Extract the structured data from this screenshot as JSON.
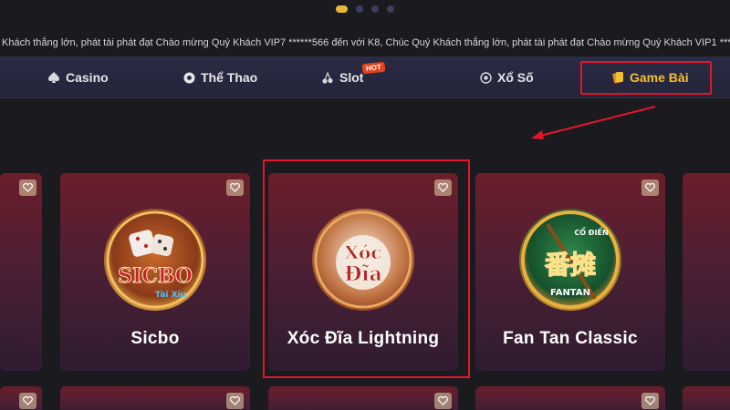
{
  "carousel": {
    "dots": 4,
    "active_index": 0
  },
  "marquee": {
    "text": "Khách thắng lớn, phát tài phát đạt Chào mừng Quý Khách VIP7 ******566 đến với K8, Chúc Quý Khách thắng lớn, phát tài phát đạt Chào mừng Quý Khách VIP1 ******"
  },
  "nav": {
    "items": [
      {
        "label": "Casino",
        "icon": "spade-icon"
      },
      {
        "label": "Thể Thao",
        "icon": "soccer-ball-icon"
      },
      {
        "label": "Slot",
        "icon": "cherry-icon",
        "badge": "HOT"
      },
      {
        "label": "Xổ Số",
        "icon": "lottery-ball-icon"
      },
      {
        "label": "Game Bài",
        "icon": "cards-icon",
        "active": true
      }
    ]
  },
  "games": [
    {
      "title": "Sicbo",
      "logo_text": "SICBO",
      "logo_sub": "Tài Xỉu"
    },
    {
      "title": "Xóc Đĩa Lightning",
      "logo_text": "Xóc",
      "logo_sub": "Đĩa"
    },
    {
      "title": "Fan Tan Classic",
      "logo_top": "CỔ ĐIỂN",
      "logo_text": "番摊",
      "logo_sub": "FANTAN"
    }
  ],
  "colors": {
    "accent_gold": "#f2c030",
    "highlight_red": "#e3152b",
    "hot_badge": "#e2431f"
  }
}
